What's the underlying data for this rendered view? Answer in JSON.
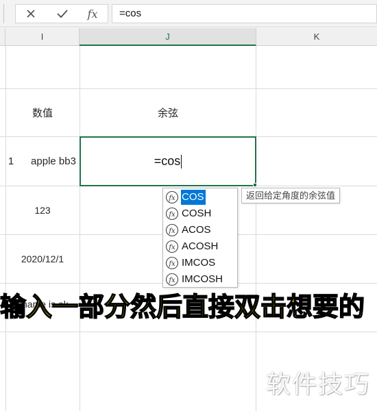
{
  "formula_bar": {
    "cancel_icon": "close-icon",
    "enter_icon": "check-icon",
    "function_icon": "fx-icon",
    "function_label": "fx",
    "formula_value": "=cos"
  },
  "column_headers": [
    "I",
    "J",
    "K"
  ],
  "cells": {
    "I_label": "数值",
    "J_label": "余弦",
    "row_number": "1",
    "I_apple": "apple bb3",
    "I_num": "123",
    "I_date": "2020/12/1",
    "I_name_partial": "name is ok"
  },
  "active_cell": {
    "edit_text": "=cos"
  },
  "autocomplete": {
    "items": [
      {
        "label": "COS",
        "selected": true
      },
      {
        "label": "COSH"
      },
      {
        "label": "ACOS"
      },
      {
        "label": "ACOSH"
      },
      {
        "label": "IMCOS"
      },
      {
        "label": "IMCOSH"
      }
    ],
    "tooltip": "返回给定角度的余弦值"
  },
  "overlay": {
    "caption": "输入一部分然后直接双击想要的",
    "watermark": "软件技巧"
  },
  "colors": {
    "accent_green": "#217346",
    "selection_blue": "#0078d7",
    "caption_yellow": "#ffd800"
  }
}
